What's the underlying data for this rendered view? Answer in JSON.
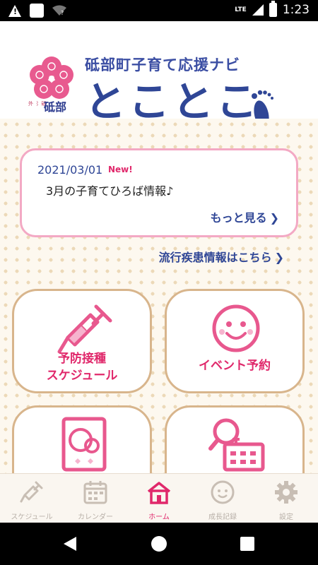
{
  "status_bar": {
    "time": "1:23",
    "network": "LTE"
  },
  "header": {
    "subtitle": "砥部町子育て応援ナビ",
    "brand": "とことこ",
    "town_small": "砥部",
    "logo_icon": "plum-blossom-logo",
    "foot_icon": "footprint-icon"
  },
  "news": {
    "date": "2021/03/01",
    "new_badge": "New!",
    "text": "3月の子育てひろば情報♪",
    "more_label": "もっと見る",
    "chevron": "❯"
  },
  "epidemic_link": {
    "label": "流行疾患情報はこちら",
    "chevron": "❯"
  },
  "tiles": [
    {
      "label": "予防接種\nスケジュール",
      "icon": "syringe-icon"
    },
    {
      "label": "イベント予約",
      "icon": "smiley-face-icon"
    },
    {
      "label": "",
      "icon": "mother-child-book-icon"
    },
    {
      "label": "",
      "icon": "search-facility-icon"
    }
  ],
  "tile_labels": {
    "vaccination_line1": "予防接種",
    "vaccination_line2": "スケジュール",
    "event": "イベント予約"
  },
  "bottom_nav": [
    {
      "label": "スケジュール",
      "icon": "syringe-icon",
      "active": false
    },
    {
      "label": "カレンダー",
      "icon": "calendar-icon",
      "active": false
    },
    {
      "label": "ホーム",
      "icon": "home-icon",
      "active": true
    },
    {
      "label": "成長記録",
      "icon": "baby-face-icon",
      "active": false
    },
    {
      "label": "設定",
      "icon": "gear-icon",
      "active": false
    }
  ],
  "colors": {
    "accent_pink": "#e0286b",
    "navy": "#2f4696",
    "tile_border": "#d8b58c",
    "card_border": "#f3a9c4",
    "nav_inactive": "#b8b0a8"
  }
}
